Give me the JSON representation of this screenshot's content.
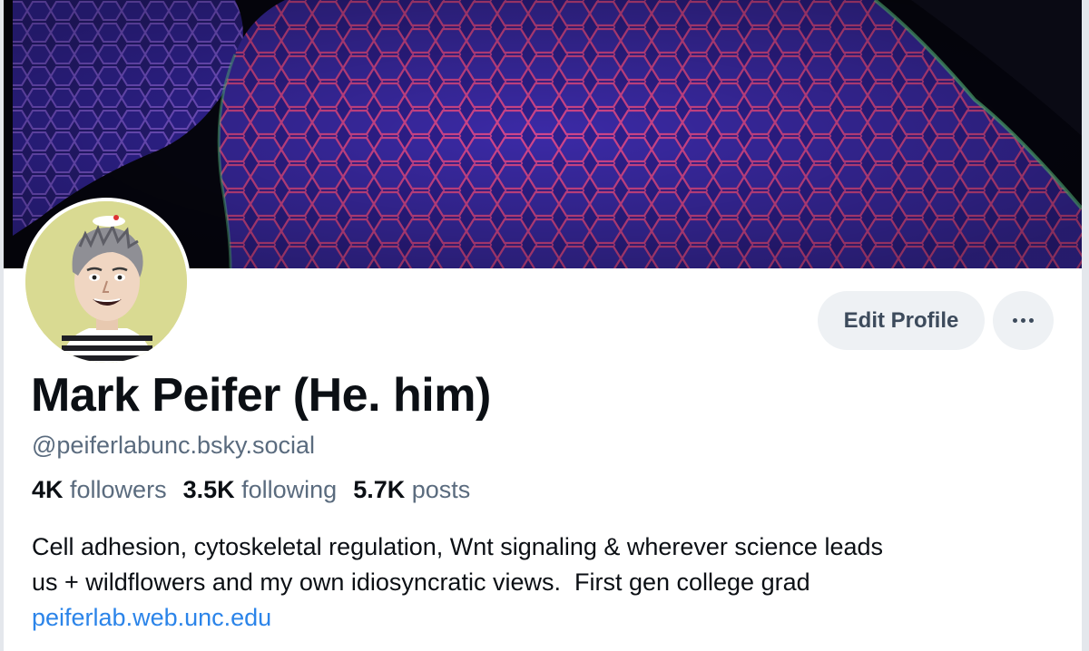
{
  "profile": {
    "display_name": "Mark Peifer (He. him)",
    "handle": "@peiferlabunc.bsky.social",
    "stats": {
      "followers_count": "4K",
      "followers_label": "followers",
      "following_count": "3.5K",
      "following_label": "following",
      "posts_count": "5.7K",
      "posts_label": "posts"
    },
    "bio_lines": [
      "Cell adhesion, cytoskeletal regulation, Wnt signaling & wherever science leads",
      "us + wildflowers and my own idiosyncratic views.  First gen college grad"
    ],
    "website": "peiferlab.web.unc.edu"
  },
  "actions": {
    "edit_profile_label": "Edit Profile",
    "more_icon": "ellipsis-icon"
  },
  "banner": {
    "description_icon": "cell-tissue-micrograph",
    "colors": {
      "background": "#060610",
      "membrane": "#e04a8a",
      "cells": "#3a2aa8",
      "edge": "#5fd08a"
    }
  },
  "colors": {
    "accent_link": "#2b84e9",
    "text_primary": "#0b0f14",
    "text_secondary": "#5a6b7e",
    "button_bg": "#eef1f4"
  }
}
